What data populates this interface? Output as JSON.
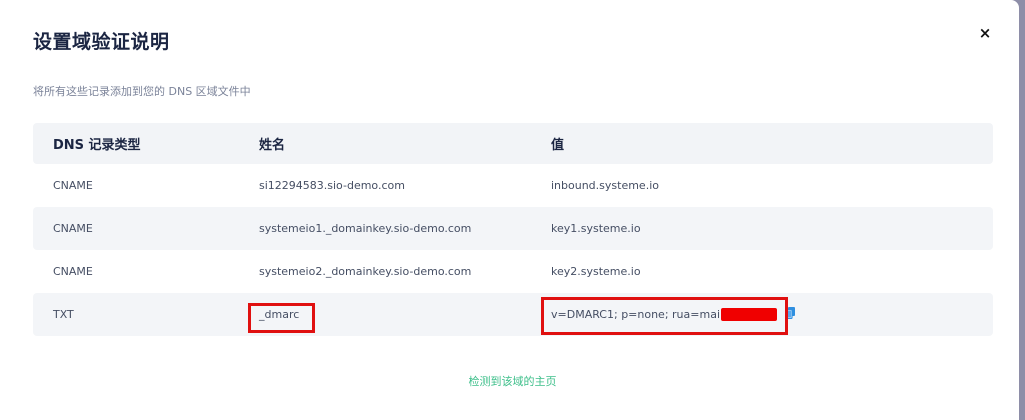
{
  "dialog": {
    "title": "设置域验证说明",
    "close_label": "×",
    "subtitle": "将所有这些记录添加到您的 DNS 区域文件中",
    "footer_link": "检测到该域的主页"
  },
  "table": {
    "headers": [
      "DNS 记录类型",
      "姓名",
      "值"
    ],
    "rows": [
      {
        "type": "CNAME",
        "name": "si12294583.sio-demo.com",
        "value": "inbound.systeme.io"
      },
      {
        "type": "CNAME",
        "name": "systemeio1._domainkey.sio-demo.com",
        "value": "key1.systeme.io"
      },
      {
        "type": "CNAME",
        "name": "systemeio2._domainkey.sio-demo.com",
        "value": "key2.systeme.io"
      },
      {
        "type": "TXT",
        "name": "_dmarc",
        "value": "v=DMARC1; p=none; rua=mai"
      }
    ]
  },
  "icons": {
    "close": "close-icon",
    "copy": "copy-icon"
  },
  "colors": {
    "accent_link": "#3dbf8a",
    "highlight_box": "#e01010",
    "redaction": "#f00000",
    "copy_icon": "#2f8fe0"
  }
}
